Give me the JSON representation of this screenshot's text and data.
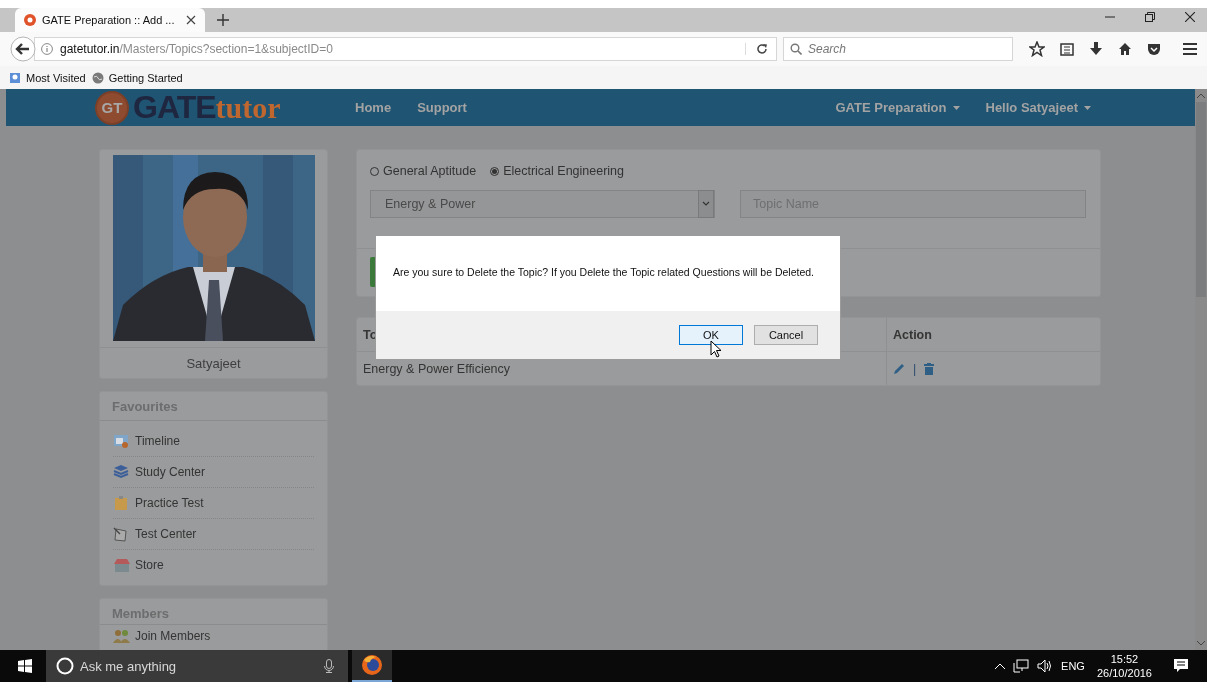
{
  "browser": {
    "tabs": [
      {
        "title": "GATE Preparation :: Add ...",
        "selected": true
      }
    ],
    "url_host": "gatetutor.in",
    "url_path": "/Masters/Topics?section=1&subjectID=0",
    "search_placeholder": "Search",
    "bookmarks": [
      "Most Visited",
      "Getting Started"
    ]
  },
  "site": {
    "logo": {
      "badge": "GT",
      "word_main": "GATE",
      "word_tail": "tutor"
    },
    "nav": [
      "Home",
      "Support"
    ],
    "menus": [
      "GATE Preparation",
      "Hello Satyajeet"
    ]
  },
  "profile": {
    "name": "Satyajeet"
  },
  "favourites": {
    "title": "Favourites",
    "items": [
      {
        "label": "Timeline",
        "kind": "timeline"
      },
      {
        "label": "Study Center",
        "kind": "books"
      },
      {
        "label": "Practice Test",
        "kind": "clipboard"
      },
      {
        "label": "Test Center",
        "kind": "paper"
      },
      {
        "label": "Store",
        "kind": "store"
      }
    ]
  },
  "members": {
    "title": "Members",
    "items": [
      {
        "label": "Join Members",
        "kind": "people"
      }
    ]
  },
  "form": {
    "subjects": [
      {
        "label": "General Aptitude",
        "selected": false
      },
      {
        "label": "Electrical Engineering",
        "selected": true
      }
    ],
    "subject_select": {
      "value": "Energy & Power"
    },
    "topic_field": {
      "placeholder": "Topic Name"
    }
  },
  "table": {
    "columns": [
      "To",
      "Action"
    ],
    "rows": [
      {
        "topic": "Energy & Power Efficiency",
        "separator": "|"
      }
    ]
  },
  "dialog": {
    "message": "Are you sure to Delete the Topic? If you Delete the Topic related Questions will be Deleted.",
    "buttons": [
      {
        "label": "OK",
        "focused": true
      },
      {
        "label": "Cancel",
        "focused": false
      }
    ]
  },
  "taskbar": {
    "search_placeholder": "Ask me anything",
    "language": "ENG",
    "time": "15:52",
    "date": "26/10/2016"
  }
}
